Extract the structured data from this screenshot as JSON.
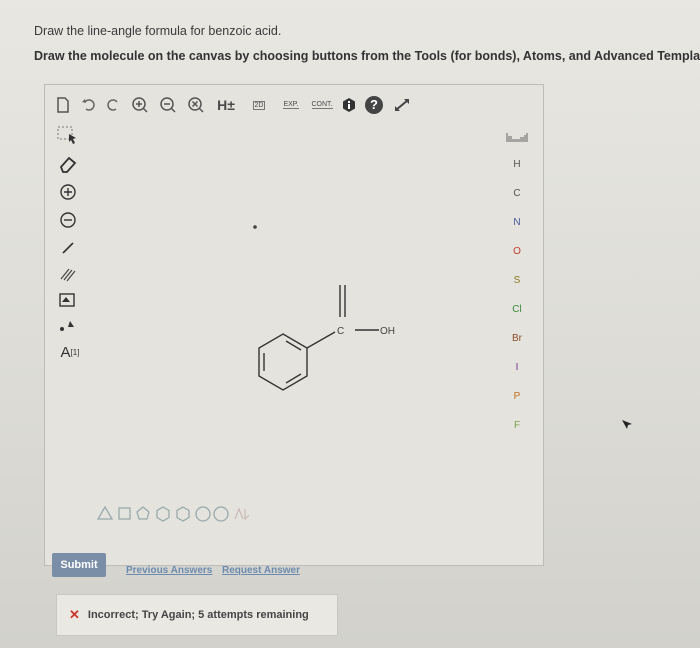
{
  "instructions": {
    "line1": "Draw the line-angle formula for benzoic acid.",
    "line2": "Draw the molecule on the canvas by choosing buttons from the Tools (for bonds), Atoms, and Advanced Templa"
  },
  "toolbar": {
    "h_label": "H±",
    "twod_label": "2D",
    "exp_label": "EXP.",
    "cont_label": "CONT.",
    "info_icon": "info-icon",
    "help_label": "?"
  },
  "left_tools": {
    "charge_label": "A",
    "charge_sup": "[1]"
  },
  "molecule": {
    "carbon_label": "C",
    "oh_label": "OH"
  },
  "atoms": [
    "H",
    "C",
    "N",
    "O",
    "S",
    "Cl",
    "Br",
    "I",
    "P",
    "F"
  ],
  "atom_colors": {
    "H": "#555555",
    "C": "#555555",
    "N": "#4a5a9a",
    "O": "#c0392b",
    "S": "#8a7a20",
    "Cl": "#3a8a3a",
    "Br": "#8a4a2a",
    "I": "#6a3a8a",
    "P": "#c07020",
    "F": "#7aa04a"
  },
  "periodic_icon": "periodic-table-icon",
  "actions": {
    "submit_label": "Submit",
    "previous_answers": "Previous Answers",
    "request_answer": "Request Answer"
  },
  "feedback": {
    "icon": "x-icon",
    "text": "Incorrect; Try Again; 5 attempts remaining"
  }
}
